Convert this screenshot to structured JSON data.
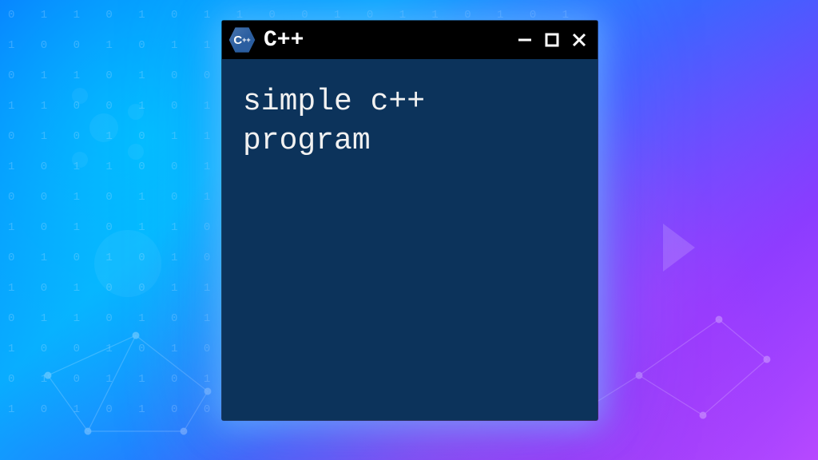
{
  "window": {
    "title": "C++",
    "logo_letter": "C",
    "logo_plus": "++",
    "content_text": "simple c++\nprogram",
    "controls": {
      "minimize_name": "minimize-icon",
      "maximize_name": "maximize-icon",
      "close_name": "close-icon"
    }
  },
  "colors": {
    "client_bg": "#0c335b",
    "titlebar_bg": "#000000",
    "text": "#f1f1f1"
  }
}
